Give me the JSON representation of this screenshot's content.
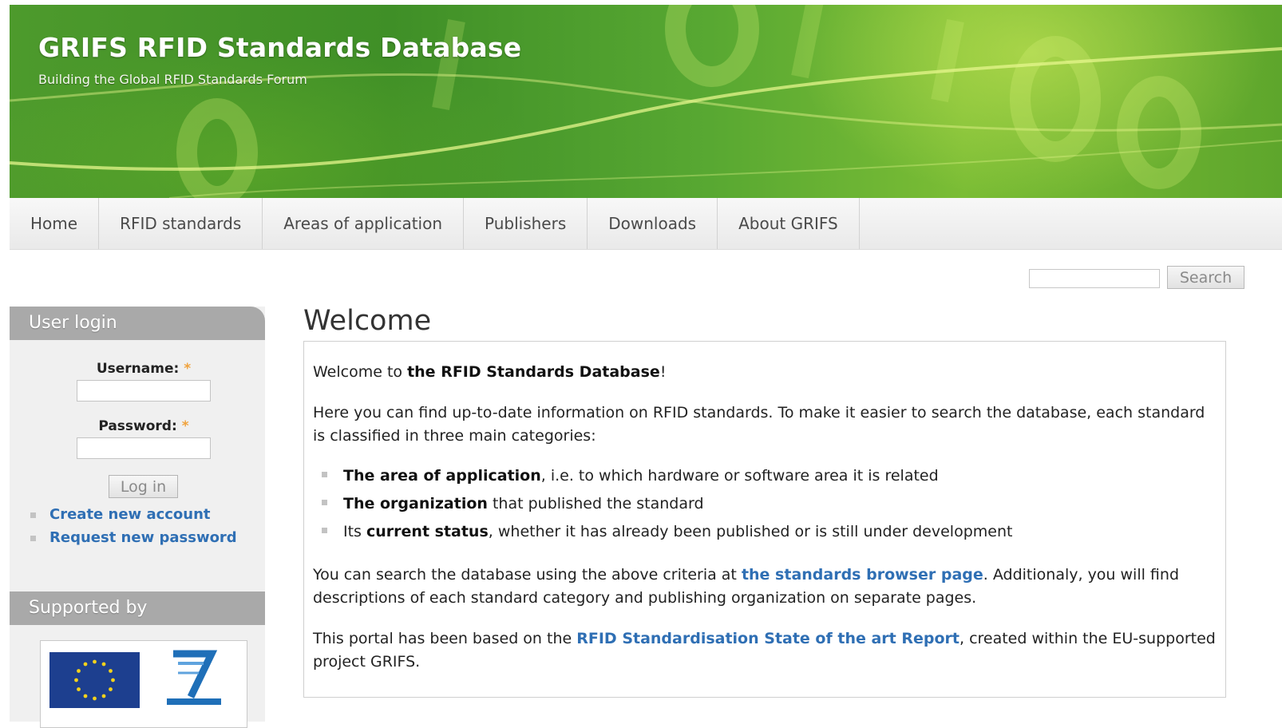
{
  "site": {
    "title": "GRIFS RFID Standards Database",
    "slogan": "Building the Global RFID Standards Forum"
  },
  "nav": {
    "items": [
      {
        "label": "Home"
      },
      {
        "label": "RFID standards"
      },
      {
        "label": "Areas of application"
      },
      {
        "label": "Publishers"
      },
      {
        "label": "Downloads"
      },
      {
        "label": "About GRIFS"
      }
    ]
  },
  "search": {
    "value": "",
    "button_label": "Search"
  },
  "sidebar": {
    "login": {
      "title": "User login",
      "username_label": "Username:",
      "password_label": "Password:",
      "required_mark": "*",
      "username_value": "",
      "password_value": "",
      "login_button": "Log in",
      "links": [
        {
          "label": "Create new account"
        },
        {
          "label": "Request new password"
        }
      ]
    },
    "supported": {
      "title": "Supported by"
    }
  },
  "main": {
    "title": "Welcome",
    "intro": {
      "pre": "Welcome to ",
      "bold": "the RFID Standards Database",
      "post": "!"
    },
    "paragraph1": "Here you can find up-to-date information on RFID standards. To make it easier to search the database, each standard is classified in three main categories:",
    "categories": [
      {
        "pre": "",
        "bold": "The area of application",
        "post": ", i.e. to which hardware or software area it is related"
      },
      {
        "pre": "",
        "bold": "The organization",
        "post": " that published the standard"
      },
      {
        "pre": "Its ",
        "bold": "current status",
        "post": ", whether it has already been published or is still under development"
      }
    ],
    "paragraph2": {
      "pre": "You can search the database using the above criteria at ",
      "link": "the standards browser page",
      "post": ". Additionaly, you will find descriptions of each standard category and publishing organization on separate pages."
    },
    "paragraph3": {
      "pre": "This portal has been based on the ",
      "link": "RFID Standardisation State of the art Report",
      "post": ", created within the EU-supported project GRIFS."
    }
  },
  "colors": {
    "header_green": "#4d9a2c",
    "link_blue": "#2f6fb4",
    "sidebar_title_gray": "#a9a9a9",
    "required_orange": "#f0a23c"
  }
}
